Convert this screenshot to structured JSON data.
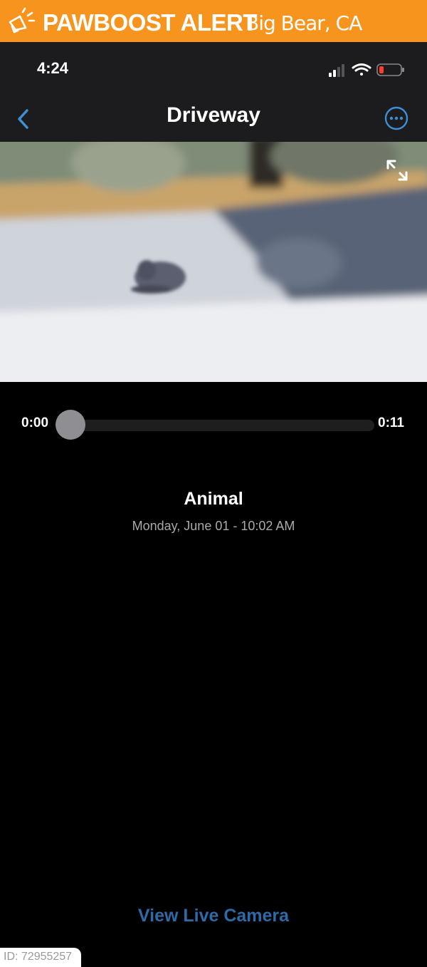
{
  "banner": {
    "brand": "PAWBOOST ALERT",
    "location": "Big Bear, CA",
    "color": "#f7941d"
  },
  "statusbar": {
    "time": "4:24",
    "icons": [
      "signal-icon",
      "wifi-icon",
      "battery-low-icon"
    ]
  },
  "nav": {
    "title": "Driveway",
    "back_icon": "chevron-left-icon",
    "more_icon": "ellipsis-circle-icon",
    "accent": "#3d8fd6"
  },
  "video": {
    "expand_icon": "expand-arrows-icon"
  },
  "player": {
    "current": "0:00",
    "duration": "0:11",
    "progress": 0.0
  },
  "event": {
    "title": "Animal",
    "timestamp": "Monday, June 01 - 10:02 AM"
  },
  "actions": {
    "live_label": "View Live Camera"
  },
  "footer": {
    "id_label": "ID: 72955257"
  }
}
